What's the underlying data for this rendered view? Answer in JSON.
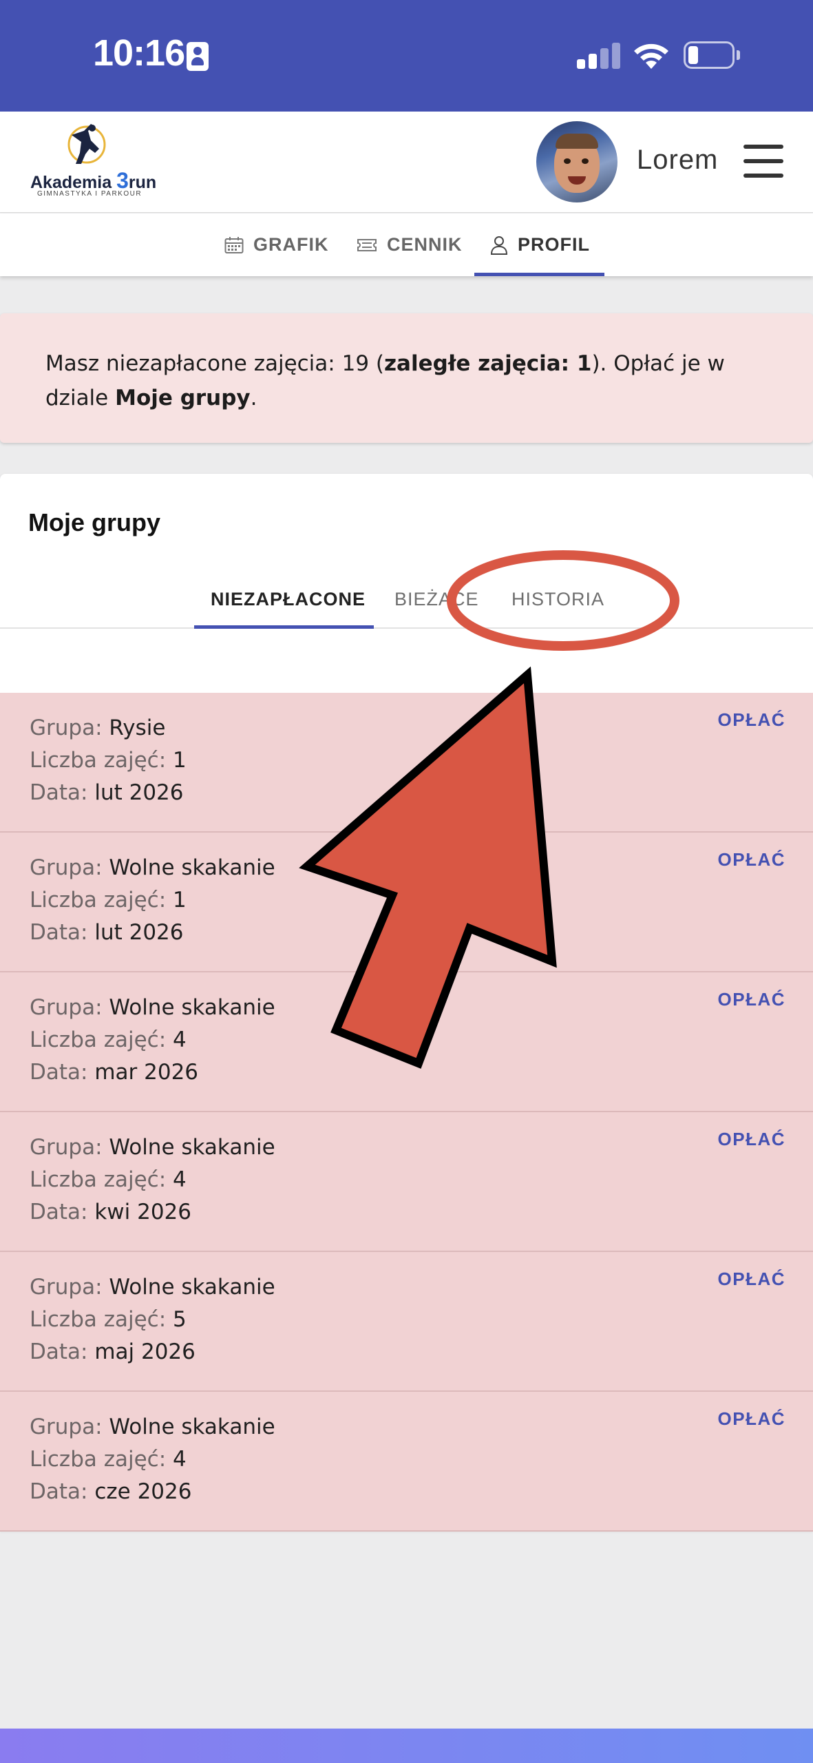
{
  "status_bar": {
    "time": "10:16",
    "icons": [
      "contact-card-icon",
      "cellular-signal-icon",
      "wifi-icon",
      "battery-icon"
    ]
  },
  "header": {
    "logo": {
      "name": "Akademia ",
      "number": "3",
      "suffix": "run",
      "subtitle": "GIMNASTYKA I PARKOUR"
    },
    "user_name": "Lorem",
    "menu_icon": "hamburger-menu-icon"
  },
  "nav": {
    "items": [
      {
        "label": "GRAFIK",
        "icon": "calendar-icon",
        "active": false
      },
      {
        "label": "CENNIK",
        "icon": "ticket-icon",
        "active": false
      },
      {
        "label": "PROFIL",
        "icon": "user-icon",
        "active": true
      }
    ],
    "accent_color": "#4451b2"
  },
  "alert": {
    "text_1": "Masz niezapłacone zajęcia: ",
    "count": "19",
    "text_2": " (",
    "overdue": "zaległe zajęcia: 1",
    "text_3": "). Opłać je w dziale ",
    "link": "Moje grupy",
    "text_4": "."
  },
  "groups": {
    "title": "Moje grupy",
    "tabs": [
      {
        "label": "NIEZAPŁACONE",
        "active": true
      },
      {
        "label": "BIEŻĄCE",
        "active": false
      },
      {
        "label": "HISTORIA",
        "active": false
      }
    ],
    "labels": {
      "group": "Grupa: ",
      "count": "Liczba zajęć: ",
      "date": "Data: "
    },
    "pay_label": "OPŁAĆ",
    "rows": [
      {
        "group": "Rysie",
        "count": "1",
        "date": "lut 2026"
      },
      {
        "group": "Wolne skakanie",
        "count": "1",
        "date": "lut 2026"
      },
      {
        "group": "Wolne skakanie",
        "count": "4",
        "date": "mar 2026"
      },
      {
        "group": "Wolne skakanie",
        "count": "4",
        "date": "kwi 2026"
      },
      {
        "group": "Wolne skakanie",
        "count": "5",
        "date": "maj 2026"
      },
      {
        "group": "Wolne skakanie",
        "count": "4",
        "date": "cze 2026"
      }
    ]
  },
  "colors": {
    "status_bar": "#4451b2",
    "row_background": "#f1d2d3",
    "alert_background": "#f7e2e2",
    "annotation_red": "#d95744"
  }
}
